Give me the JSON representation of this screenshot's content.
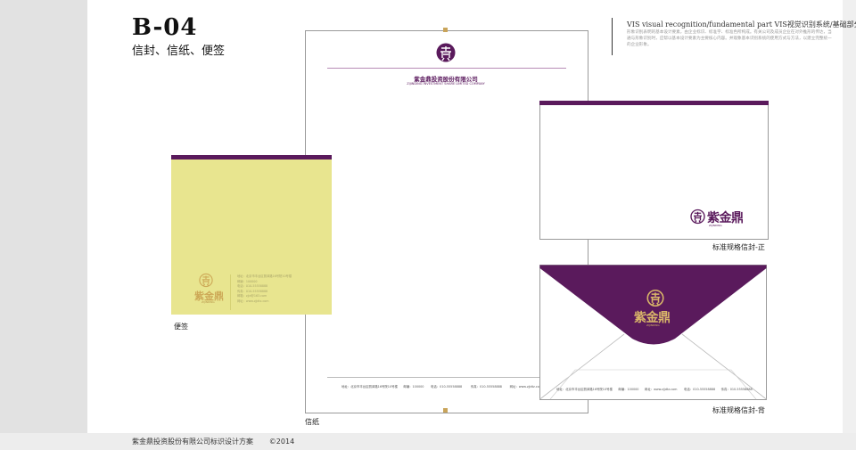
{
  "header": {
    "code": "B-04",
    "subtitle": "信封、信纸、便签",
    "vis_title": "VIS visual recognition/fundamental part   VIS视觉识别系统/基础部分",
    "vis_desc": "形象识别表明的基本设计要素，由企业标识、标准字、标准色所构成。有关公司及成员企业在对外推形的传达，当通与形象识别时，应帮以基本设计要素为主要核心内容。并观象基本识别系统的使用方式与方法，以建立完整统一的企业形象。"
  },
  "company": {
    "name_cn": "紫金鼎投资股份有限公司",
    "name_en": "ZIJINDING INVESTMENT SHARE LIMITED COMPANY",
    "brand": "紫金鼎",
    "brand_en": "ZIJINDING"
  },
  "letterhead": {
    "label": "信纸",
    "footer": "地址：北京市丰台区丽泽路16号院10号楼      邮编：100000       电话：010-55558888         传真：010-55558888        网址：www.zjjdtz.com"
  },
  "memo": {
    "label": "便签",
    "info": "地址：北京市丰台区丽泽路16号院10号楼\n邮编：100000\n电话：010-55558888\n传真：010-55558888\n邮箱：zjjd@163.com\n网址：www.zjjdtz.com"
  },
  "envelope_front": {
    "label": "标准规格信封-正"
  },
  "envelope_back": {
    "label": "标准规格信封-背",
    "footer": "地址：北京市丰台区丽泽路16号院10号楼      邮编：100000      网址：www.zjjdtz.com       电话：010-55558888      传真：010-55558888"
  },
  "footer": {
    "text": "紫金鼎投资股份有限公司标识设计方案       ©2014"
  },
  "colors": {
    "brand_purple": "#5a1a5c",
    "gold": "#cda957",
    "memo_yellow": "#e8e58f"
  }
}
